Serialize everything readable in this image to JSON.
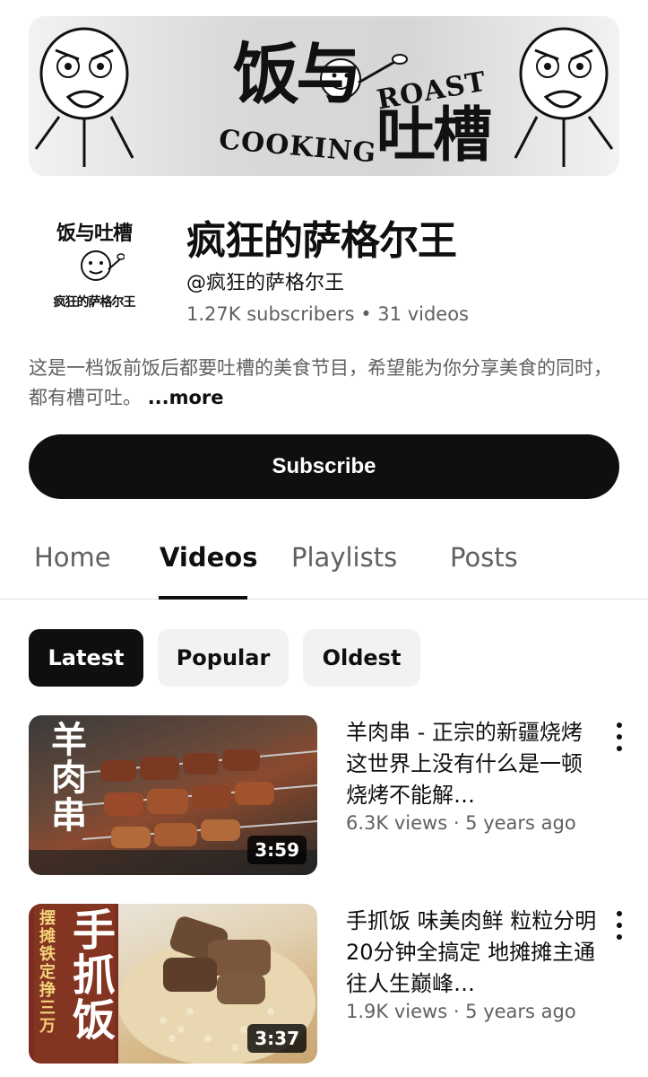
{
  "banner": {
    "title": "饭与",
    "roast": "ROAST",
    "cooking": "COOKING",
    "sub": "吐槽"
  },
  "channel": {
    "avatar_top": "饭与吐槽",
    "avatar_bottom": "疯狂的萨格尔王",
    "name": "疯狂的萨格尔王",
    "handle": "@疯狂的萨格尔王",
    "stats": "1.27K subscribers • 31 videos",
    "description": "这是一档饭前饭后都要吐槽的美食节目，希望能为你分享美食的同时，都有槽可吐。",
    "more_label": "...more",
    "subscribe_label": "Subscribe"
  },
  "tabs": [
    "Home",
    "Videos",
    "Playlists",
    "Posts"
  ],
  "active_tab": "Videos",
  "chips": [
    "Latest",
    "Popular",
    "Oldest"
  ],
  "active_chip": "Latest",
  "videos": [
    {
      "title": "羊肉串 - 正宗的新疆烧烤 这世界上没有什么是一顿烧烤不能解…",
      "meta": "6.3K views · 5 years ago",
      "duration": "3:59",
      "thumb_text": "羊肉串"
    },
    {
      "title": "手抓饭 味美肉鲜 粒粒分明 20分钟全搞定 地摊摊主通往人生巅峰…",
      "meta": "1.9K views · 5 years ago",
      "duration": "3:37",
      "thumb_text": "手抓饭",
      "thumb_side": "摆摊铁定挣三万"
    }
  ],
  "colors": {
    "primary": "#0f0f0f",
    "secondary_text": "#606060",
    "chip_bg": "#f2f2f2",
    "background": "#ffffff"
  }
}
